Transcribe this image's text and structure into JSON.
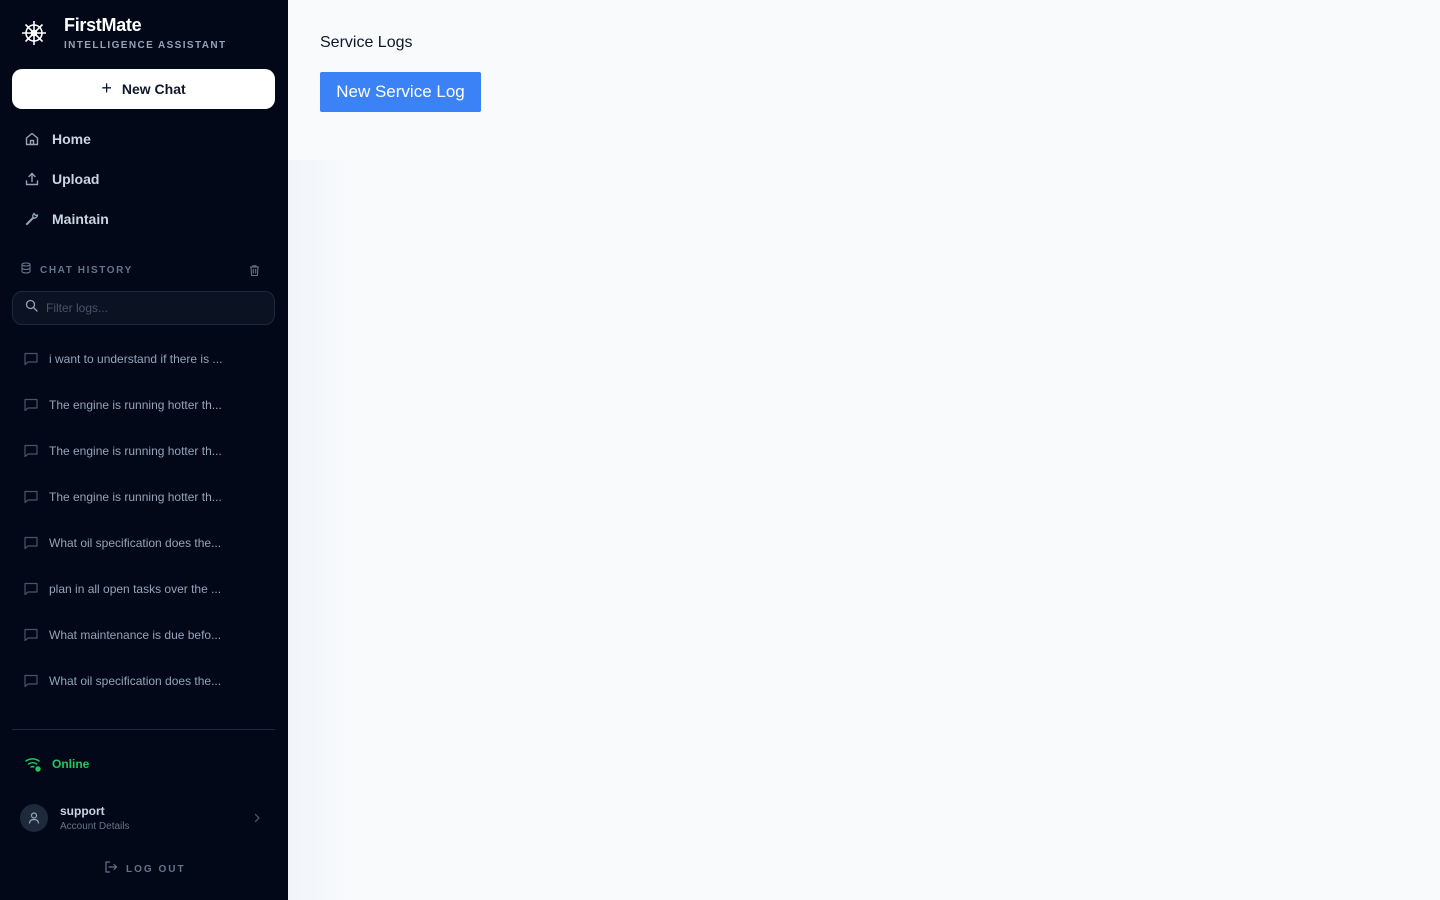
{
  "brand": {
    "name": "FirstMate",
    "subtitle": "INTELLIGENCE ASSISTANT",
    "logo_icon": "ship-wheel-icon"
  },
  "sidebar": {
    "new_chat_label": "New Chat",
    "nav": [
      {
        "label": "Home",
        "icon": "home-icon"
      },
      {
        "label": "Upload",
        "icon": "upload-icon"
      },
      {
        "label": "Maintain",
        "icon": "wrench-icon"
      }
    ],
    "history": {
      "title": "CHAT HISTORY",
      "filter_placeholder": "Filter logs...",
      "items": [
        "i want to understand if there is ...",
        "The engine is running hotter th...",
        "The engine is running hotter th...",
        "The engine is running hotter th...",
        "What oil specification does the...",
        "plan in all open tasks over the ...",
        "What maintenance is due befo...",
        "What oil specification does the..."
      ]
    },
    "status": {
      "label": "Online",
      "color": "#22c55e"
    },
    "account": {
      "name": "support",
      "subtitle": "Account Details"
    },
    "logout_label": "LOG OUT"
  },
  "main": {
    "title": "Service Logs",
    "new_log_label": "New Service Log",
    "accent": "#3b82f6"
  }
}
